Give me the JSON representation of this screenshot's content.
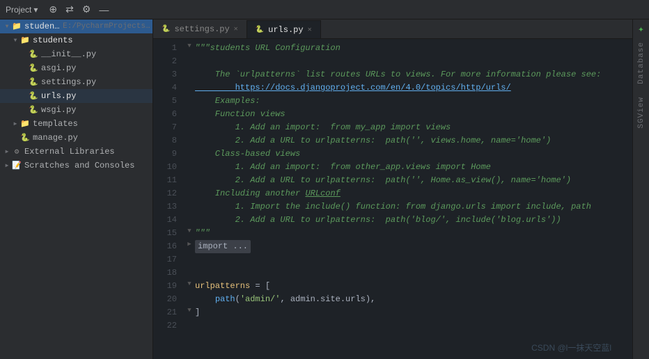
{
  "titlebar": {
    "project_label": "Project",
    "icons": [
      "⊕",
      "⇄",
      "⚙",
      "—"
    ]
  },
  "sidebar": {
    "root_label": "students",
    "root_path": "E:/PycharmProjects/stu",
    "items": [
      {
        "id": "students-root",
        "label": "students",
        "type": "folder",
        "depth": 1,
        "expanded": true
      },
      {
        "id": "init",
        "label": "__init__.py",
        "type": "py",
        "depth": 2
      },
      {
        "id": "asgi",
        "label": "asgi.py",
        "type": "py",
        "depth": 2
      },
      {
        "id": "settings",
        "label": "settings.py",
        "type": "py",
        "depth": 2
      },
      {
        "id": "urls",
        "label": "urls.py",
        "type": "py",
        "depth": 2,
        "active": true
      },
      {
        "id": "wsgi",
        "label": "wsgi.py",
        "type": "py",
        "depth": 2
      },
      {
        "id": "templates",
        "label": "templates",
        "type": "folder",
        "depth": 1
      },
      {
        "id": "manage",
        "label": "manage.py",
        "type": "py",
        "depth": 1
      },
      {
        "id": "external-libs",
        "label": "External Libraries",
        "type": "ext",
        "depth": 0
      },
      {
        "id": "scratches",
        "label": "Scratches and Consoles",
        "type": "scratch",
        "depth": 0
      }
    ]
  },
  "tabs": [
    {
      "id": "settings-tab",
      "label": "settings.py",
      "active": false,
      "closeable": true
    },
    {
      "id": "urls-tab",
      "label": "urls.py",
      "active": true,
      "closeable": true
    }
  ],
  "code": {
    "lines": [
      {
        "num": 1,
        "fold": "▼",
        "content": [
          {
            "cls": "c-comment",
            "text": "\"\"\"students URL Configuration"
          }
        ]
      },
      {
        "num": 2,
        "fold": "",
        "content": []
      },
      {
        "num": 3,
        "fold": "",
        "content": [
          {
            "cls": "c-comment",
            "text": "    The `urlpatterns` list routes URLs to views. For more information please see:"
          }
        ]
      },
      {
        "num": 4,
        "fold": "",
        "content": [
          {
            "cls": "c-link",
            "text": "        https://docs.djangoproject.com/en/4.0/topics/http/urls/"
          }
        ]
      },
      {
        "num": 5,
        "fold": "",
        "content": [
          {
            "cls": "c-comment",
            "text": "    Examples:"
          }
        ]
      },
      {
        "num": 6,
        "fold": "",
        "content": [
          {
            "cls": "c-comment",
            "text": "    Function views"
          }
        ]
      },
      {
        "num": 7,
        "fold": "",
        "content": [
          {
            "cls": "c-comment",
            "text": "        1. Add an import:  from my_app import views"
          }
        ]
      },
      {
        "num": 8,
        "fold": "",
        "content": [
          {
            "cls": "c-comment",
            "text": "        2. Add a URL to urlpatterns:  path('', views.home, name='home')"
          }
        ]
      },
      {
        "num": 9,
        "fold": "",
        "content": [
          {
            "cls": "c-comment",
            "text": "    Class-based views"
          }
        ]
      },
      {
        "num": 10,
        "fold": "",
        "content": [
          {
            "cls": "c-comment",
            "text": "        1. Add an import:  from other_app.views import Home"
          }
        ]
      },
      {
        "num": 11,
        "fold": "",
        "content": [
          {
            "cls": "c-comment",
            "text": "        2. Add a URL to urlpatterns:  path('', Home.as_view(), name='home')"
          }
        ]
      },
      {
        "num": 12,
        "fold": "",
        "content": [
          {
            "cls": "c-comment",
            "text": "    Including another URLconf"
          }
        ]
      },
      {
        "num": 13,
        "fold": "",
        "content": [
          {
            "cls": "c-comment",
            "text": "        1. Import the include() function: from django.urls import include, path"
          }
        ]
      },
      {
        "num": 14,
        "fold": "",
        "content": [
          {
            "cls": "c-comment",
            "text": "        2. Add a URL to urlpatterns:  path('blog/', include('blog.urls'))"
          }
        ]
      },
      {
        "num": 15,
        "fold": "▼",
        "content": [
          {
            "cls": "c-comment",
            "text": "\"\"\""
          }
        ]
      },
      {
        "num": 16,
        "fold": "▶",
        "content": [
          {
            "cls": "c-folded",
            "text": "import ..."
          },
          {
            "cls": "c-normal",
            "text": ""
          }
        ]
      },
      {
        "num": 17,
        "fold": "",
        "content": []
      },
      {
        "num": 18,
        "fold": "",
        "content": []
      },
      {
        "num": 19,
        "fold": "▼",
        "content": [
          {
            "cls": "c-variable",
            "text": "urlpatterns"
          },
          {
            "cls": "c-normal",
            "text": " = ["
          },
          {
            "cls": "c-normal",
            "text": ""
          }
        ]
      },
      {
        "num": 20,
        "fold": "",
        "content": [
          {
            "cls": "c-normal",
            "text": "    "
          },
          {
            "cls": "c-blue",
            "text": "path"
          },
          {
            "cls": "c-normal",
            "text": "("
          },
          {
            "cls": "c-string",
            "text": "'admin/'"
          },
          {
            "cls": "c-normal",
            "text": ", admin.site.urls),"
          },
          {
            "cls": "c-normal",
            "text": ""
          }
        ]
      },
      {
        "num": 21,
        "fold": "▼",
        "content": [
          {
            "cls": "c-normal",
            "text": "]"
          }
        ]
      },
      {
        "num": 22,
        "fold": "",
        "content": []
      }
    ]
  },
  "right_sidebar": {
    "db_label": "Database",
    "sgview_label": "SGView"
  },
  "watermark": "CSDN @l一抹天空蓝l"
}
